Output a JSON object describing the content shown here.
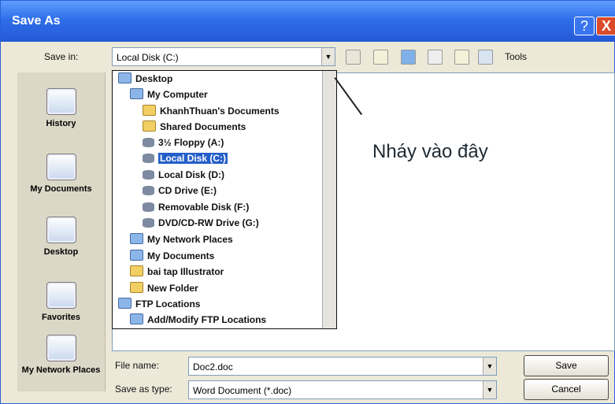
{
  "window": {
    "title": "Save As",
    "help": "?",
    "close": "X"
  },
  "top": {
    "save_in_label": "Save in:",
    "location": "Local Disk (C:)",
    "tools": "Tools"
  },
  "places": [
    {
      "label": "History"
    },
    {
      "label": "My Documents"
    },
    {
      "label": "Desktop"
    },
    {
      "label": "Favorites"
    },
    {
      "label": "My Network Places"
    }
  ],
  "dropdown": {
    "items": [
      {
        "label": "Desktop"
      },
      {
        "label": "My Computer"
      },
      {
        "label": "KhanhThuan's Documents"
      },
      {
        "label": "Shared Documents"
      },
      {
        "label": "3½ Floppy (A:)"
      },
      {
        "label": "Local Disk (C:)"
      },
      {
        "label": "Local Disk (D:)"
      },
      {
        "label": "CD Drive (E:)"
      },
      {
        "label": "Removable Disk (F:)"
      },
      {
        "label": "DVD/CD-RW Drive (G:)"
      },
      {
        "label": "My Network Places"
      },
      {
        "label": "My Documents"
      },
      {
        "label": "bai tap Illustrator"
      },
      {
        "label": "New Folder"
      },
      {
        "label": "FTP Locations"
      },
      {
        "label": "Add/Modify FTP Locations"
      }
    ]
  },
  "note": "Nháy vào đây",
  "file": {
    "name_label": "File name:",
    "name_value": "Doc2.doc",
    "type_label": "Save as type:",
    "type_value": "Word Document (*.doc)"
  },
  "buttons": {
    "save": "Save",
    "cancel": "Cancel"
  },
  "colors": {
    "title_bar": "#2f6ee9",
    "selection": "#245ec9",
    "close_button": "#db4b2a"
  }
}
